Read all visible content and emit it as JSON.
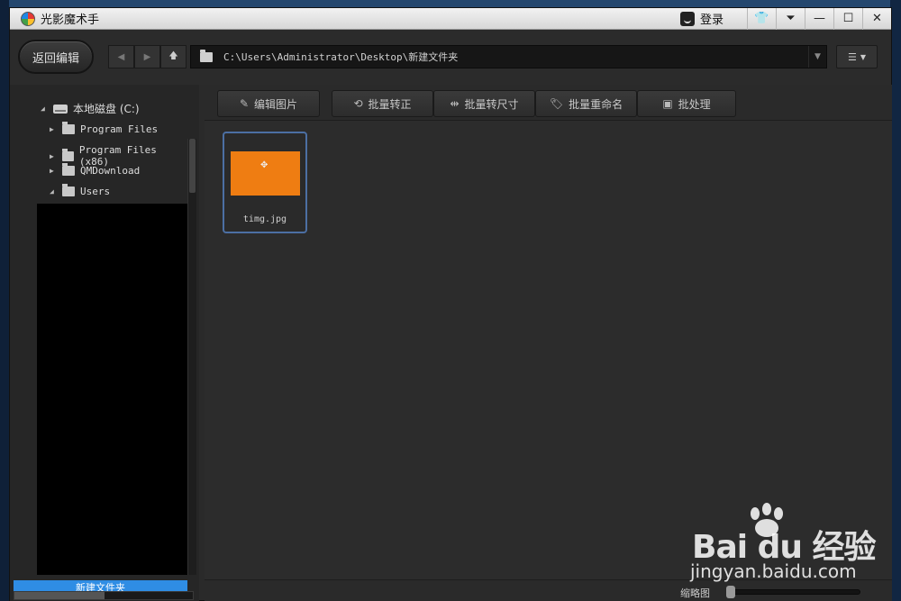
{
  "window": {
    "app_title": "光影魔术手",
    "login_label": "登录"
  },
  "toolbar": {
    "back_label": "返回编辑",
    "path": "C:\\Users\\Administrator\\Desktop\\新建文件夹"
  },
  "sidebar": {
    "tree": [
      {
        "label": "本地磁盘 (C:)",
        "type": "drive",
        "expanded": true
      },
      {
        "label": "Program Files",
        "type": "folder",
        "expanded": false
      },
      {
        "label": "Program Files (x86)",
        "type": "folder",
        "expanded": false
      },
      {
        "label": "QMDownload",
        "type": "folder",
        "expanded": false
      },
      {
        "label": "Users",
        "type": "folder",
        "expanded": true
      }
    ],
    "new_folder_label": "新建文件夹"
  },
  "actions": {
    "edit_image": "编辑图片",
    "batch_rotate": "批量转正",
    "batch_resize": "批量转尺寸",
    "batch_rename": "批量重命名",
    "batch_process": "批处理"
  },
  "files": [
    {
      "name": "timg.jpg",
      "thumb_color": "#ef7d12",
      "selected": true
    }
  ],
  "status": {
    "thumb_size_label": "缩略图",
    "zoom_level": 0
  },
  "watermark": {
    "brand": "Bai du 经验",
    "url": "jingyan.baidu.com"
  },
  "colors": {
    "accent": "#4c6fa3",
    "highlight": "#2f8de4",
    "thumbnail": "#ef7d12"
  }
}
